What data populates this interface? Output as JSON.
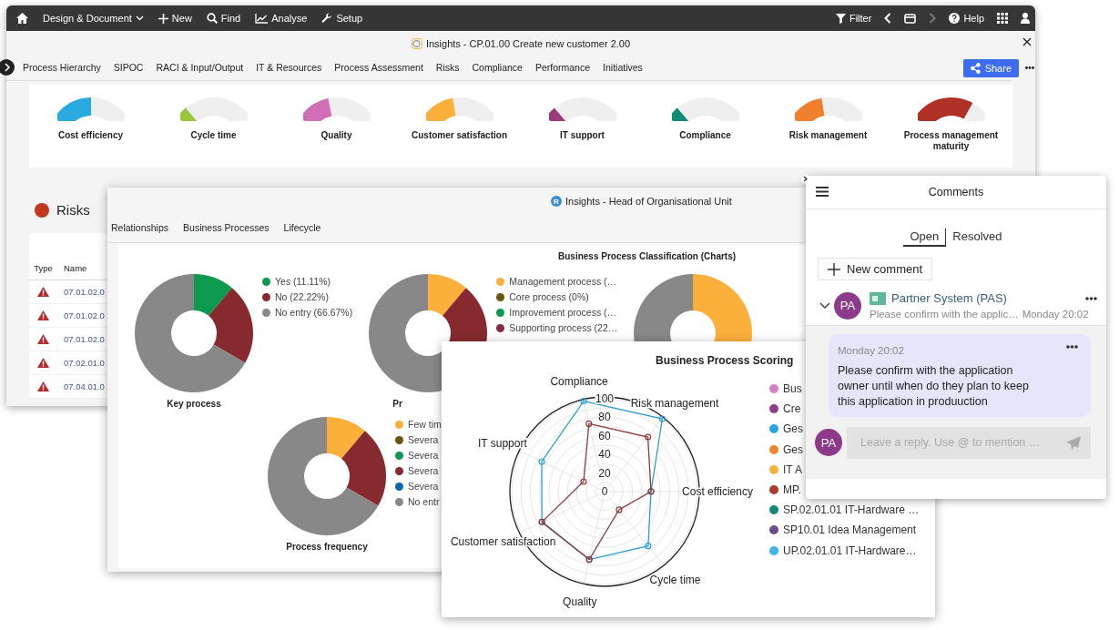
{
  "topbar": {
    "menu": [
      {
        "label": "Design & Document",
        "kind": "dropdown"
      },
      {
        "label": "New",
        "kind": "plus"
      },
      {
        "label": "Find",
        "kind": "search"
      },
      {
        "label": "Analyse",
        "kind": "chart"
      },
      {
        "label": "Setup",
        "kind": "wrench"
      }
    ],
    "filter": "Filter",
    "nav": [
      {
        "kind": "back",
        "disabled": false
      },
      {
        "kind": "window",
        "disabled": false
      },
      {
        "kind": "forward",
        "disabled": true
      }
    ],
    "help": "Help"
  },
  "main_window": {
    "title": "Insights - CP.01.00 Create new customer 2.00",
    "tabs": [
      {
        "label": "Process Hierarchy",
        "selected": false
      },
      {
        "label": "SIPOC",
        "selected": false
      },
      {
        "label": "RACI & Input/Output",
        "selected": false
      },
      {
        "label": "IT & Resources",
        "selected": false
      },
      {
        "label": "Process Assessment",
        "selected": false
      },
      {
        "label": "Risks",
        "selected": false
      },
      {
        "label": "Compliance",
        "selected": false
      },
      {
        "label": "Performance",
        "selected": false
      },
      {
        "label": "Initiatives",
        "selected": false
      }
    ],
    "share": "Share",
    "gauges": [
      {
        "label": "Cost efficiency",
        "level": 0.5,
        "color": "#29abe2"
      },
      {
        "label": "Cycle time",
        "level": 0.15,
        "color": "#9bc53d"
      },
      {
        "label": "Quality",
        "level": 0.4,
        "color": "#d16eb8"
      },
      {
        "label": "Customer satisfaction",
        "level": 0.42,
        "color": "#fbb03b"
      },
      {
        "label": "IT support",
        "level": 0.15,
        "color": "#9c3a7c"
      },
      {
        "label": "Compliance",
        "level": 0.15,
        "color": "#0f8a75"
      },
      {
        "label": "Risk management",
        "level": 0.42,
        "color": "#f07f2e"
      },
      {
        "label": "Process management maturity",
        "level": 0.75,
        "color": "#b03125"
      }
    ],
    "risks": {
      "title": "Risks",
      "columns": [
        "Type",
        "Name"
      ],
      "rows": [
        {
          "name": "07.01.02.0"
        },
        {
          "name": "07.01.02.0"
        },
        {
          "name": "07.01.02.0"
        },
        {
          "name": "07.02.01.0"
        },
        {
          "name": "07.04.01.0"
        }
      ]
    }
  },
  "unit_window": {
    "badge": "R",
    "title": "Insights - Head of Organisational Unit",
    "tabs": [
      {
        "label": "Relationships",
        "selected": false
      },
      {
        "label": "Business Processes",
        "selected": false
      },
      {
        "label": "Lifecycle",
        "selected": false
      }
    ],
    "section_title": "Business Process Classification (Charts)",
    "charts": [
      {
        "title": "Key process",
        "legend": [
          {
            "color": "#0e9a4e"
          },
          {
            "color": "#862a2f"
          },
          {
            "color": "#888888"
          }
        ],
        "chart_data": {
          "type": "donut",
          "categories": [
            "Yes (11.11%)",
            "No (22.22%)",
            "No entry (66.67%)"
          ],
          "values": [
            11.11,
            22.22,
            66.67
          ]
        }
      },
      {
        "title": "Pr",
        "legend": [
          {
            "label": "Management process (…",
            "color": "#fbb03b"
          },
          {
            "label": "Core process (0%)",
            "color": "#6b5410"
          },
          {
            "label": "Improvement process (…",
            "color": "#0e9a4e"
          },
          {
            "label": "Supporting process (22…",
            "color": "#862a4a"
          }
        ]
      },
      {
        "title": "Process frequency",
        "legend": [
          {
            "label": "Few tim",
            "color": "#fbb03b"
          },
          {
            "label": "Severa",
            "color": "#6b5410"
          },
          {
            "label": "Severa",
            "color": "#0e9a4e"
          },
          {
            "label": "Severa",
            "color": "#862a2f"
          },
          {
            "label": "Severa",
            "color": "#0a66b0"
          },
          {
            "label": "No entr",
            "color": "#888888"
          }
        ]
      }
    ]
  },
  "scoring_window": {
    "title": "Business Process Scoring",
    "axes": [
      "Compliance",
      "Risk management",
      "IT support",
      "Cost efficiency",
      "Customer satisfaction",
      "Cycle time",
      "Quality"
    ],
    "ticks": [
      "100",
      "80",
      "60",
      "40",
      "20",
      "0"
    ],
    "legend": [
      {
        "label": "Bus",
        "color": "#d77fc5"
      },
      {
        "label": "Cre",
        "color": "#8e3d86"
      },
      {
        "label": "Ges",
        "color": "#2aa7df"
      },
      {
        "label": "Ges",
        "color": "#f0842c"
      },
      {
        "label": "IT A",
        "color": "#fbb03b"
      },
      {
        "label": "MP.",
        "color": "#b03a2e"
      },
      {
        "label": "SP.02.01.01 IT-Hardware …",
        "color": "#138a72"
      },
      {
        "label": "SP10.01 Idea Management",
        "color": "#6b4c8c"
      },
      {
        "label": "UP.02.01.01 IT-Hardware…",
        "color": "#3db5ea"
      }
    ]
  },
  "comments": {
    "title": "Comments",
    "tabs": [
      {
        "label": "Open",
        "selected": true
      },
      {
        "label": "Resolved",
        "selected": false
      }
    ],
    "new_comment": "New comment",
    "thread": {
      "expanded": true,
      "initials": "PA",
      "object": "Partner System (PAS)",
      "preview": "Please confirm with the applic…",
      "time": "Monday 20:02",
      "messages": [
        {
          "time": "Monday 20:02",
          "text": "Please confirm with the application owner until when do they plan to keep this application in produuction"
        }
      ]
    },
    "reply": {
      "initials": "PA",
      "placeholder": "Leave a reply. Use @ to mention …"
    }
  }
}
